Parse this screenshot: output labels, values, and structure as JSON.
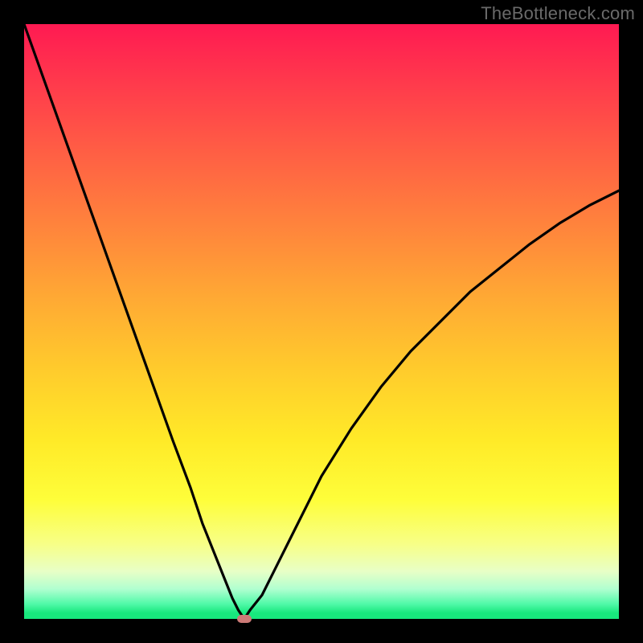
{
  "watermark": "TheBottleneck.com",
  "colors": {
    "frame": "#000000",
    "gradient_top": "#ff1a52",
    "gradient_bottom": "#18e87d",
    "curve": "#000000",
    "marker": "#cd7a77"
  },
  "chart_data": {
    "type": "line",
    "title": "",
    "xlabel": "",
    "ylabel": "",
    "xlim": [
      0,
      100
    ],
    "ylim": [
      0,
      100
    ],
    "grid": false,
    "legend": false,
    "minimum_marker": {
      "x": 37,
      "y": 0
    },
    "series": [
      {
        "name": "bottleneck-curve",
        "x": [
          0,
          5,
          10,
          15,
          20,
          25,
          28,
          30,
          32,
          34,
          35,
          36,
          37,
          38,
          40,
          42,
          45,
          50,
          55,
          60,
          65,
          70,
          75,
          80,
          85,
          90,
          95,
          100
        ],
        "values": [
          100,
          86,
          72,
          58,
          44,
          30,
          22,
          16,
          11,
          6,
          3.5,
          1.5,
          0,
          1.5,
          4,
          8,
          14,
          24,
          32,
          39,
          45,
          50,
          55,
          59,
          63,
          66.5,
          69.5,
          72
        ]
      }
    ]
  }
}
